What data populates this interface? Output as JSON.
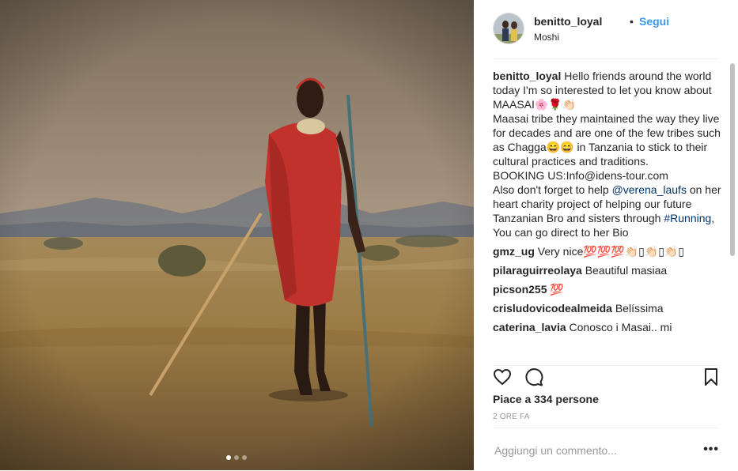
{
  "post": {
    "image_alt": "Maasai man in red shuka holding spear and staff in savannah",
    "carousel": {
      "count": 3,
      "active": 0
    }
  },
  "header": {
    "username": "benitto_loyal",
    "separator": "•",
    "follow_label": "Segui",
    "location": "Moshi"
  },
  "caption": {
    "username": "benitto_loyal",
    "text_1": " Hello friends around the world today I'm so interested to let you know about MAASAI🌸🌹👏🏻\nMaasai tribe they maintained the way they live for decades and are one of the few tribes such as Chagga😄😄 in Tanzania to stick to their cultural practices and traditions.\nBOOKING US:Info@idens-tour.com\nAlso don't forget to help ",
    "mention": "@verena_laufs",
    "text_2": " on her heart charity project of helping our future Tanzanian Bro and sisters through ",
    "hashtag": "#Running",
    "text_3": ", You can go direct to her Bio"
  },
  "comments": [
    {
      "username": "gmz_ug",
      "text": "Very nice💯💯💯👏🏻▯👏🏻▯👏🏻▯"
    },
    {
      "username": "pilaraguirreolaya",
      "text": "Beautiful masiaa"
    },
    {
      "username": "picson255",
      "text": "💯"
    },
    {
      "username": "crisludovicodealmeida",
      "text": "Belíssima"
    },
    {
      "username": "caterina_lavia",
      "text": "Conosco i Masai.. mi"
    }
  ],
  "actions": {
    "like_icon": "heart-icon",
    "comment_icon": "comment-icon",
    "save_icon": "bookmark-icon"
  },
  "likes_text": "Piace a 334 persone",
  "timestamp": "2 ORE FA",
  "add_comment": {
    "placeholder": "Aggiungi un commento...",
    "more_label": "•••"
  },
  "colors": {
    "link": "#003569",
    "follow": "#3897f0",
    "text": "#262626",
    "muted": "#999999",
    "shuka_red": "#c2322c"
  }
}
